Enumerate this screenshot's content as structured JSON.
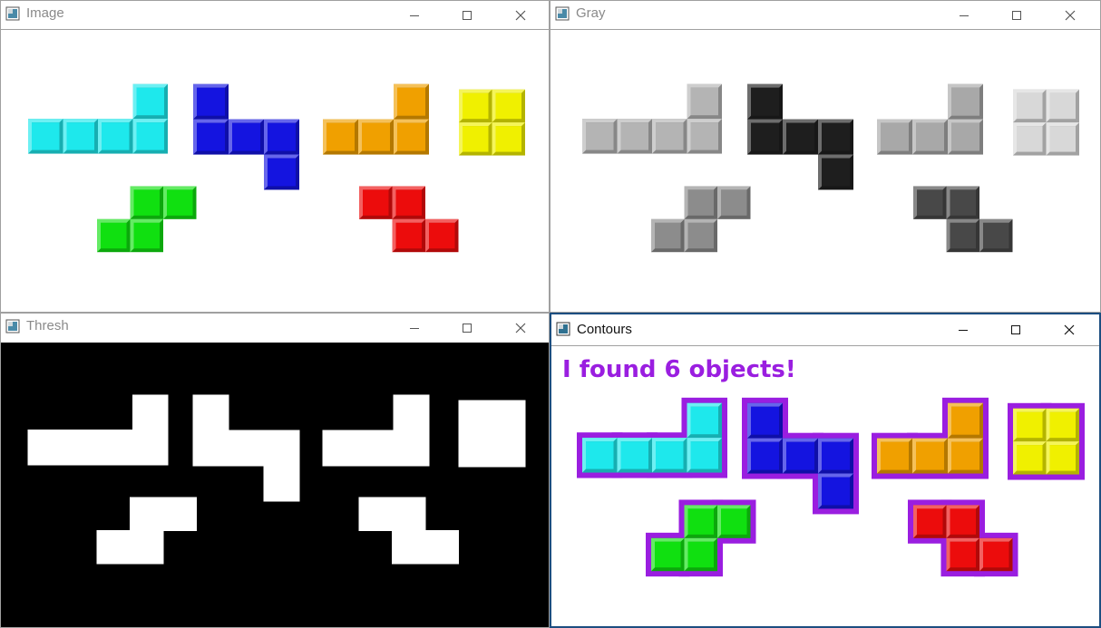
{
  "windows": [
    {
      "id": "image",
      "title": "Image"
    },
    {
      "id": "gray",
      "title": "Gray"
    },
    {
      "id": "thresh",
      "title": "Thresh"
    },
    {
      "id": "contours",
      "title": "Contours"
    }
  ],
  "contours": {
    "caption": "I found 6 objects!"
  },
  "colors": {
    "cyan": "#1ee8ec",
    "blue": "#1414e0",
    "orange": "#f0a000",
    "yellow": "#f0f000",
    "green": "#10e010",
    "red": "#ec0c0c",
    "outline": "#9a1ee0",
    "gray_cyan": "#b4b4b4",
    "gray_blue": "#1e1e1e",
    "gray_orange": "#a8a8a8",
    "gray_yellow": "#d8d8d8",
    "gray_green": "#8c8c8c",
    "gray_red": "#484848"
  },
  "icons": [
    "window-app-icon",
    "minimize-icon",
    "maximize-icon",
    "close-icon"
  ]
}
